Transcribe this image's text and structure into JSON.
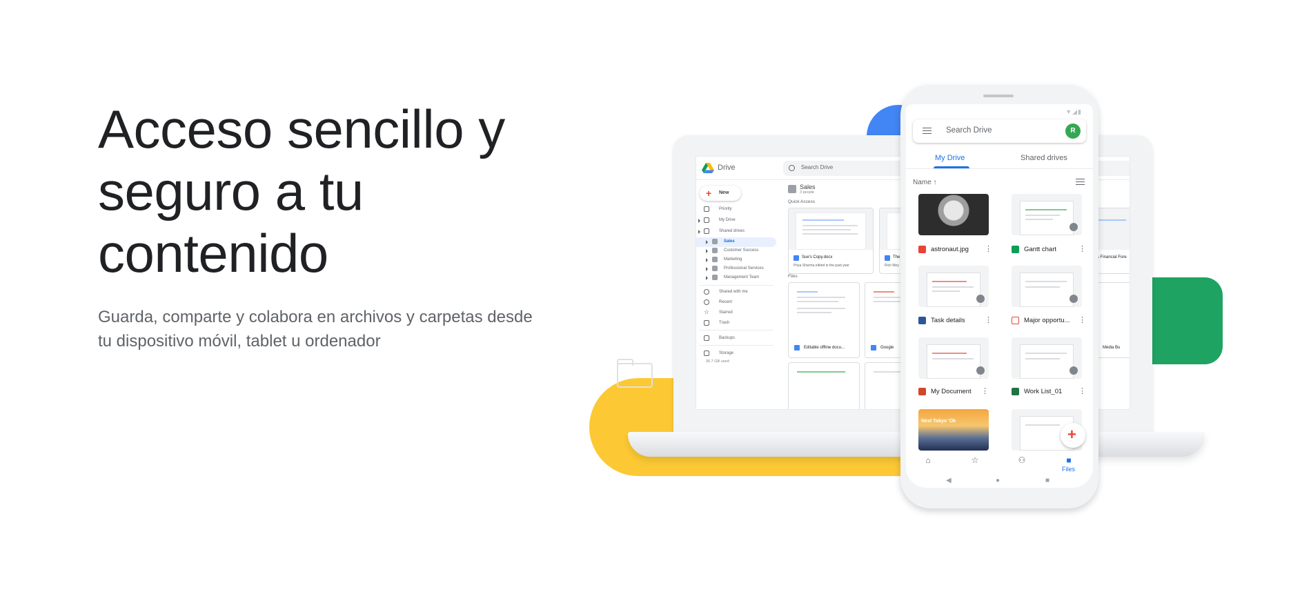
{
  "hero": {
    "title": "Acceso sencillo y seguro a tu contenido",
    "subtitle": "Guarda, comparte y colabora en archivos y carpetas desde tu dispositivo móvil, tablet u ordenador"
  },
  "laptop": {
    "app_name": "Drive",
    "search_placeholder": "Search Drive",
    "new_button": "New",
    "nav": [
      "Priority",
      "My Drive",
      "Shared drives"
    ],
    "shared_drives": [
      "Sales",
      "Customer Success",
      "Marketing",
      "Professional Services",
      "Management Team"
    ],
    "nav_bottom": [
      "Shared with me",
      "Recent",
      "Starred",
      "Trash"
    ],
    "backups": "Backups",
    "storage": "Storage",
    "storage_used": "30.7 GB used",
    "folder_title": "Sales",
    "folder_subtitle": "3 people",
    "quick_access_label": "Quick Access",
    "files_label": "Files",
    "quick_access": [
      {
        "title": "Sue's Copy.docx",
        "subtitle": "Priya Sharma edited in the past year"
      },
      {
        "title": "The",
        "subtitle": "Rich Mey"
      }
    ],
    "files": [
      "Editable offline docu...",
      "Google"
    ],
    "partial_right_title": "doors Financial Fore",
    "partial_right_file": "Media Bu"
  },
  "phone": {
    "status_icons": "▼◢▮",
    "search_placeholder": "Search Drive",
    "avatar_letter": "R",
    "tabs": [
      "My Drive",
      "Shared drives"
    ],
    "sort_label": "Name ↑",
    "files": [
      {
        "name": "astronaut.jpg",
        "icon": "image-icon",
        "color": "#ea4335"
      },
      {
        "name": "Gantt chart",
        "icon": "sheets-icon",
        "color": "#0f9d58"
      },
      {
        "name": "Task details",
        "icon": "word-icon",
        "color": "#2b579a"
      },
      {
        "name": "Major opportu...",
        "icon": "pdf-icon",
        "color": "#ea4335"
      },
      {
        "name": "My Document",
        "icon": "powerpoint-icon",
        "color": "#d24726"
      },
      {
        "name": "Work List_01",
        "icon": "excel-icon",
        "color": "#217346"
      }
    ],
    "bottom_nav_files": "Files",
    "tokyo_caption": "Next Tokyo 'Ok"
  }
}
